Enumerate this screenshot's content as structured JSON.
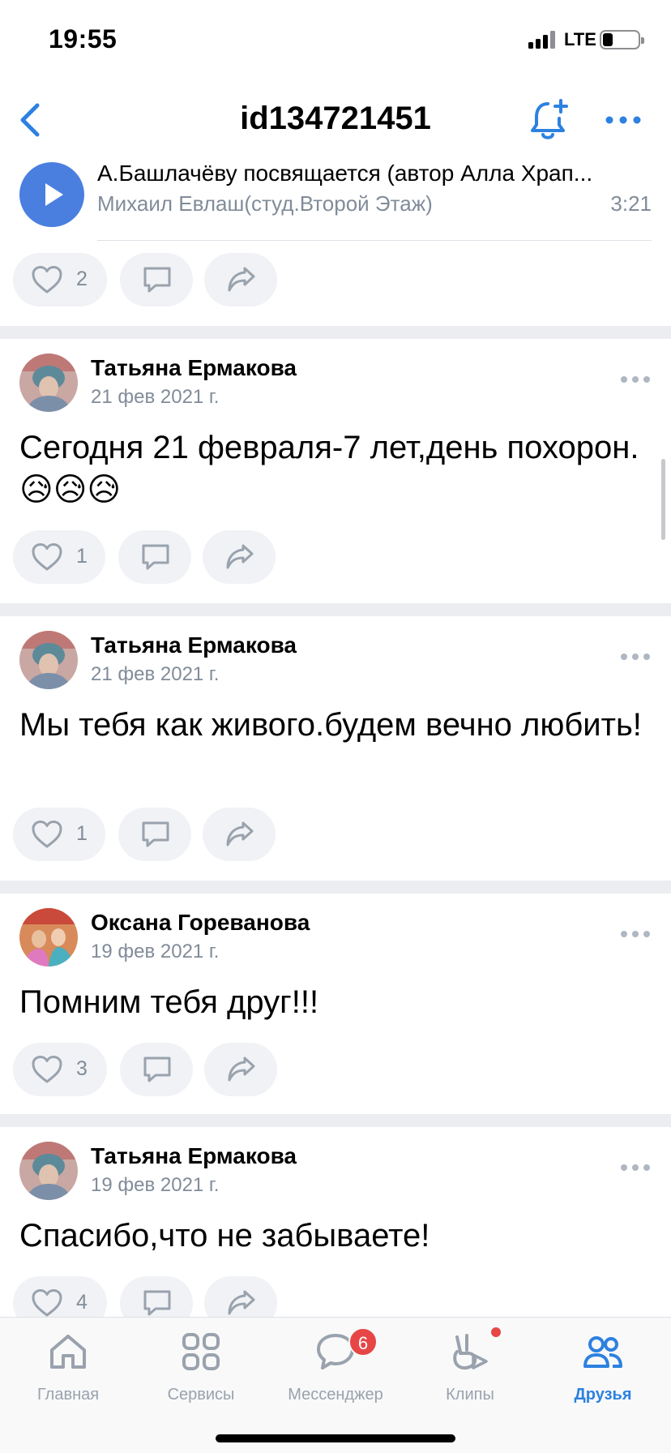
{
  "status": {
    "time": "19:55",
    "network": "LTE"
  },
  "nav": {
    "title": "id134721451"
  },
  "audio": {
    "title": "А.Башлачёву посвящается (автор Алла Храп...",
    "artist": "Михаил Евлаш(студ.Второй Этаж)",
    "duration": "3:21",
    "likes": "2"
  },
  "posts": [
    {
      "author": "Татьяна Ермакова",
      "date": "21 фев 2021 г.",
      "text": "Сегодня 21 февраля-7 лет,день похорон.😥😥😥",
      "likes": "1"
    },
    {
      "author": "Татьяна Ермакова",
      "date": "21 фев 2021 г.",
      "text": "Мы тебя как живого.будем вечно любить!",
      "likes": "1"
    },
    {
      "author": "Оксана Гореванова",
      "date": "19 фев 2021 г.",
      "text": "Помним тебя друг!!!",
      "likes": "3"
    },
    {
      "author": "Татьяна Ермакова",
      "date": "19 фев 2021 г.",
      "text": "Спасибо,что не забываете!",
      "likes": "4"
    }
  ],
  "tabs": [
    {
      "label": "Главная",
      "icon": "home-icon"
    },
    {
      "label": "Сервисы",
      "icon": "services-icon"
    },
    {
      "label": "Мессенджер",
      "icon": "messenger-icon",
      "badge": "6"
    },
    {
      "label": "Клипы",
      "icon": "clips-icon"
    },
    {
      "label": "Друзья",
      "icon": "friends-icon"
    }
  ],
  "colors": {
    "accent": "#2d81e0",
    "play": "#4a7fe0",
    "badge": "#e64646",
    "muted": "#818c99"
  }
}
